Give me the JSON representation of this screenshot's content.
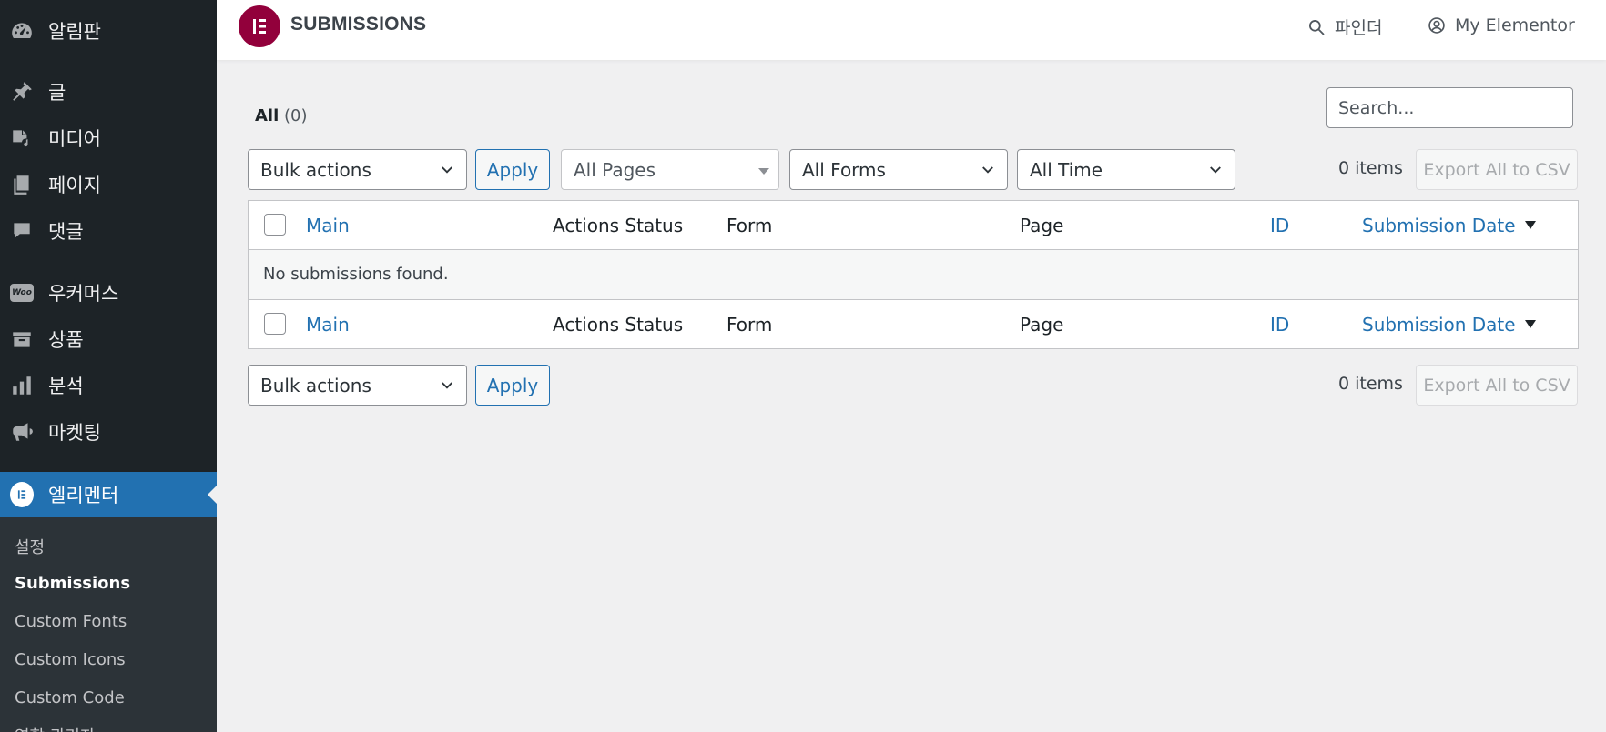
{
  "sidebar": {
    "items": [
      {
        "label": "알림판",
        "icon": "dashboard-icon"
      },
      {
        "label": "글",
        "icon": "pin-icon"
      },
      {
        "label": "미디어",
        "icon": "media-icon"
      },
      {
        "label": "페이지",
        "icon": "pages-icon"
      },
      {
        "label": "댓글",
        "icon": "comments-icon"
      },
      {
        "label": "우커머스",
        "icon": "woocommerce-icon",
        "badge": "Woo"
      },
      {
        "label": "상품",
        "icon": "products-icon"
      },
      {
        "label": "분석",
        "icon": "analytics-icon"
      },
      {
        "label": "마켓팅",
        "icon": "megaphone-icon"
      },
      {
        "label": "엘리멘터",
        "icon": "elementor-icon"
      }
    ],
    "submenu": [
      "설정",
      "Submissions",
      "Custom Fonts",
      "Custom Icons",
      "Custom Code",
      "역할 관리자"
    ]
  },
  "topbar": {
    "title": "SUBMISSIONS",
    "finder": "파인더",
    "my_elementor": "My Elementor"
  },
  "filters": {
    "status_all": "All",
    "status_count": "(0)",
    "search_placeholder": "Search...",
    "bulk_actions": "Bulk actions",
    "apply": "Apply",
    "pages": "All Pages",
    "forms": "All Forms",
    "time": "All Time",
    "items": "0 items",
    "export": "Export All to CSV"
  },
  "table": {
    "columns": [
      "Main",
      "Actions Status",
      "Form",
      "Page",
      "ID",
      "Submission Date"
    ],
    "empty_message": "No submissions found."
  },
  "colors": {
    "sidebar_bg": "#1d2327",
    "accent": "#2271b1",
    "elementor_brand": "#92003b"
  }
}
